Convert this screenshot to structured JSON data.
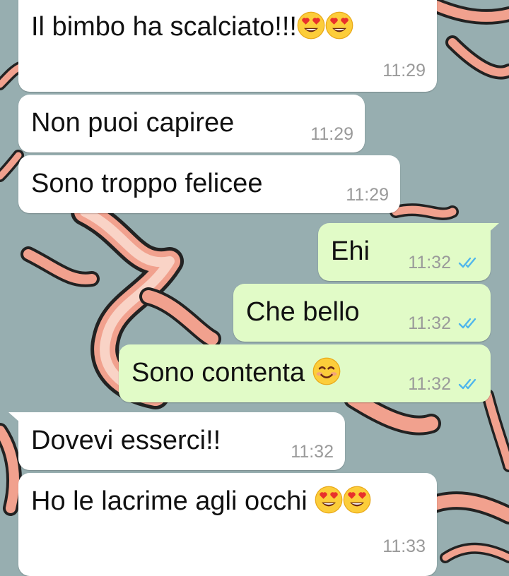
{
  "messages": [
    {
      "text": "Il bimbo ha scalciato!!!",
      "emoji": "heart-eyes-x2",
      "time": "11:29",
      "direction": "incoming"
    },
    {
      "text": "Non puoi capiree",
      "time": "11:29",
      "direction": "incoming"
    },
    {
      "text": "Sono troppo felicee",
      "time": "11:29",
      "direction": "incoming"
    },
    {
      "text": "Ehi",
      "time": "11:32",
      "direction": "outgoing",
      "status": "read"
    },
    {
      "text": "Che bello",
      "time": "11:32",
      "direction": "outgoing",
      "status": "read"
    },
    {
      "text": "Sono contenta",
      "emoji": "smiling-face",
      "time": "11:32",
      "direction": "outgoing",
      "status": "read"
    },
    {
      "text": "Dovevi esserci!!",
      "time": "11:32",
      "direction": "incoming"
    },
    {
      "text": "Ho le lacrime agli occhi",
      "emoji": "heart-eyes-x2",
      "time": "11:33",
      "direction": "incoming"
    }
  ],
  "colors": {
    "wallpaper": "#97aeb0",
    "incoming_bubble": "#ffffff",
    "outgoing_bubble": "#e1fbc7",
    "read_ticks": "#4fb6ec",
    "timestamp": "#9a9a9a"
  },
  "icons": {
    "read_receipt": "double-check-icon",
    "heart_eyes": "heart-eyes-emoji-icon",
    "smiling": "smiling-face-emoji-icon"
  }
}
